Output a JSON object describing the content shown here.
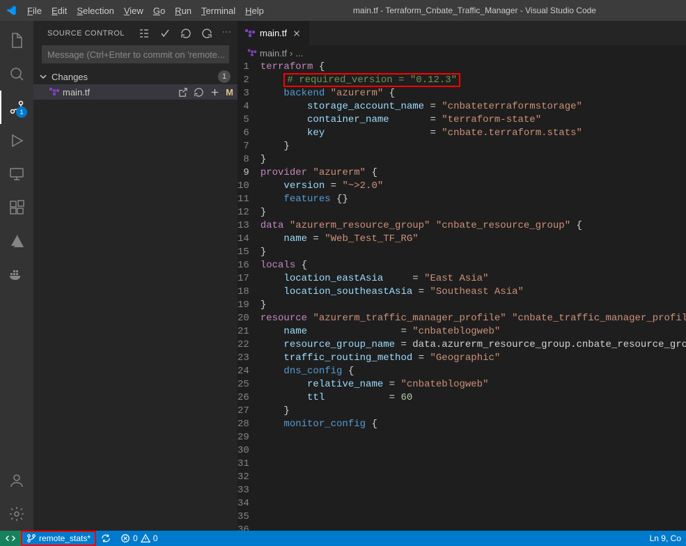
{
  "menubar": {
    "file": "File",
    "edit": "Edit",
    "selection": "Selection",
    "view": "View",
    "go": "Go",
    "run": "Run",
    "terminal": "Terminal",
    "help": "Help",
    "title": "main.tf - Terraform_Cnbate_Traffic_Manager - Visual Studio Code"
  },
  "activitybar": {
    "scm_badge": "1"
  },
  "sidebar": {
    "title": "SOURCE CONTROL",
    "commit_placeholder": "Message (Ctrl+Enter to commit on 'remote...",
    "section_label": "Changes",
    "section_count": "1",
    "file_name": "main.tf",
    "file_status": "M"
  },
  "tabs": {
    "tab_label": "main.tf"
  },
  "breadcrumbs": {
    "file": "main.tf",
    "sep": "›",
    "more": "..."
  },
  "code_lines": [
    {
      "n": "1",
      "i": 0,
      "tokens": [
        [
          "kw",
          "terraform"
        ],
        [
          "",
          " {"
        ]
      ]
    },
    {
      "n": "2",
      "i": 2,
      "redbox": true,
      "tokens": [
        [
          "cm",
          "# required_version = \"0.12.3\""
        ]
      ]
    },
    {
      "n": "3",
      "i": 2,
      "tokens": [
        [
          "id1",
          "backend "
        ],
        [
          "str",
          "\"azurerm\""
        ],
        [
          "",
          " {"
        ]
      ]
    },
    {
      "n": "4",
      "i": 4,
      "tokens": [
        [
          "id2",
          "storage_account_name"
        ],
        [
          "",
          " = "
        ],
        [
          "str",
          "\"cnbateterraformstorage\""
        ]
      ]
    },
    {
      "n": "5",
      "i": 4,
      "tokens": [
        [
          "id2",
          "container_name"
        ],
        [
          "",
          "       = "
        ],
        [
          "str",
          "\"terraform-state\""
        ]
      ]
    },
    {
      "n": "6",
      "i": 4,
      "tokens": [
        [
          "id2",
          "key"
        ],
        [
          "",
          "                  = "
        ],
        [
          "str",
          "\"cnbate.terraform.stats\""
        ]
      ]
    },
    {
      "n": "7",
      "i": 2,
      "tokens": [
        [
          "",
          "}"
        ]
      ]
    },
    {
      "n": "8",
      "i": 0,
      "tokens": [
        [
          "",
          "}"
        ]
      ]
    },
    {
      "n": "9",
      "i": 0,
      "cursor": true,
      "tokens": [
        [
          "",
          ""
        ]
      ]
    },
    {
      "n": "10",
      "i": 0,
      "tokens": [
        [
          "kw",
          "provider "
        ],
        [
          "str",
          "\"azurerm\""
        ],
        [
          "",
          " {"
        ]
      ]
    },
    {
      "n": "11",
      "i": 2,
      "tokens": [
        [
          "id2",
          "version"
        ],
        [
          "",
          " = "
        ],
        [
          "str",
          "\"~>2.0\""
        ]
      ]
    },
    {
      "n": "12",
      "i": 2,
      "tokens": [
        [
          "id1",
          "features"
        ],
        [
          "",
          " {}"
        ]
      ]
    },
    {
      "n": "13",
      "i": 0,
      "tokens": [
        [
          "",
          "}"
        ]
      ]
    },
    {
      "n": "14",
      "i": 0,
      "tokens": [
        [
          "",
          ""
        ]
      ]
    },
    {
      "n": "15",
      "i": 0,
      "tokens": [
        [
          "kw",
          "data "
        ],
        [
          "str",
          "\"azurerm_resource_group\" \"cnbate_resource_group\""
        ],
        [
          "",
          " {"
        ]
      ]
    },
    {
      "n": "16",
      "i": 2,
      "tokens": [
        [
          "id2",
          "name"
        ],
        [
          "",
          " = "
        ],
        [
          "str",
          "\"Web_Test_TF_RG\""
        ]
      ]
    },
    {
      "n": "17",
      "i": 0,
      "tokens": [
        [
          "",
          "}"
        ]
      ]
    },
    {
      "n": "18",
      "i": 0,
      "tokens": [
        [
          "",
          ""
        ]
      ]
    },
    {
      "n": "19",
      "i": 0,
      "tokens": [
        [
          "",
          ""
        ]
      ]
    },
    {
      "n": "20",
      "i": 0,
      "tokens": [
        [
          "kw",
          "locals"
        ],
        [
          "",
          " {"
        ]
      ]
    },
    {
      "n": "21",
      "i": 2,
      "tokens": [
        [
          "id2",
          "location_eastAsia"
        ],
        [
          "",
          "     = "
        ],
        [
          "str",
          "\"East Asia\""
        ]
      ]
    },
    {
      "n": "22",
      "i": 2,
      "tokens": [
        [
          "id2",
          "location_southeastAsia"
        ],
        [
          "",
          " = "
        ],
        [
          "str",
          "\"Southeast Asia\""
        ]
      ]
    },
    {
      "n": "23",
      "i": 0,
      "tokens": [
        [
          "",
          "}"
        ]
      ]
    },
    {
      "n": "24",
      "i": 0,
      "tokens": [
        [
          "",
          ""
        ]
      ]
    },
    {
      "n": "25",
      "i": 0,
      "tokens": [
        [
          "kw",
          "resource "
        ],
        [
          "str",
          "\"azurerm_traffic_manager_profile\" \"cnbate_traffic_manager_profile\""
        ]
      ]
    },
    {
      "n": "26",
      "i": 2,
      "tokens": [
        [
          "id2",
          "name"
        ],
        [
          "",
          "                = "
        ],
        [
          "str",
          "\"cnbateblogweb\""
        ]
      ]
    },
    {
      "n": "27",
      "i": 2,
      "tokens": [
        [
          "id2",
          "resource_group_name"
        ],
        [
          "",
          " = data.azurerm_resource_group.cnbate_resource_group.na"
        ]
      ]
    },
    {
      "n": "28",
      "i": 0,
      "tokens": [
        [
          "",
          ""
        ]
      ]
    },
    {
      "n": "29",
      "i": 2,
      "tokens": [
        [
          "id2",
          "traffic_routing_method"
        ],
        [
          "",
          " = "
        ],
        [
          "str",
          "\"Geographic\""
        ]
      ]
    },
    {
      "n": "30",
      "i": 0,
      "tokens": [
        [
          "",
          ""
        ]
      ]
    },
    {
      "n": "31",
      "i": 2,
      "tokens": [
        [
          "id1",
          "dns_config"
        ],
        [
          "",
          " {"
        ]
      ]
    },
    {
      "n": "32",
      "i": 4,
      "tokens": [
        [
          "id2",
          "relative_name"
        ],
        [
          "",
          " = "
        ],
        [
          "str",
          "\"cnbateblogweb\""
        ]
      ]
    },
    {
      "n": "33",
      "i": 4,
      "tokens": [
        [
          "id2",
          "ttl"
        ],
        [
          "",
          "           = "
        ],
        [
          "ce",
          "60"
        ]
      ]
    },
    {
      "n": "34",
      "i": 2,
      "tokens": [
        [
          "",
          "}"
        ]
      ]
    },
    {
      "n": "35",
      "i": 0,
      "tokens": [
        [
          "",
          ""
        ]
      ]
    },
    {
      "n": "36",
      "i": 2,
      "tokens": [
        [
          "id1",
          "monitor_config"
        ],
        [
          "",
          " {"
        ]
      ]
    }
  ],
  "statusbar": {
    "branch": "remote_stats*",
    "errors": "0",
    "warnings": "0",
    "position": "Ln 9, Co"
  }
}
